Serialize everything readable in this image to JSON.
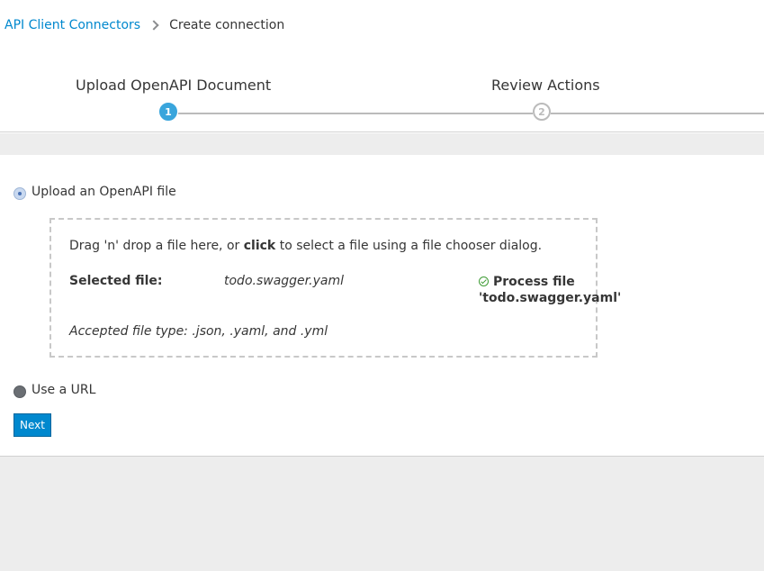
{
  "breadcrumb": {
    "parent": "API Client Connectors",
    "current": "Create connection"
  },
  "wizard": {
    "steps": [
      {
        "number": "1",
        "label": "Upload OpenAPI Document",
        "active": true
      },
      {
        "number": "2",
        "label": "Review Actions",
        "active": false
      }
    ]
  },
  "upload_option": {
    "file_label": "Upload an OpenAPI file",
    "url_label": "Use a URL",
    "selected": "file"
  },
  "dropzone": {
    "instruction_pre": "Drag 'n' drop a file here, or ",
    "instruction_bold": "click",
    "instruction_post": " to select a file using a file chooser dialog.",
    "selected_label": "Selected file:",
    "selected_file": "todo.swagger.yaml",
    "process_line1": "Process file",
    "process_line2": "'todo.swagger.yaml'",
    "accepted": "Accepted file type: .json, .yaml, and .yml"
  },
  "actions": {
    "next_label": "Next"
  },
  "colors": {
    "link": "#0088ce",
    "step_active": "#39a5dc",
    "success": "#3f9c35",
    "primary_button": "#0088ce"
  }
}
